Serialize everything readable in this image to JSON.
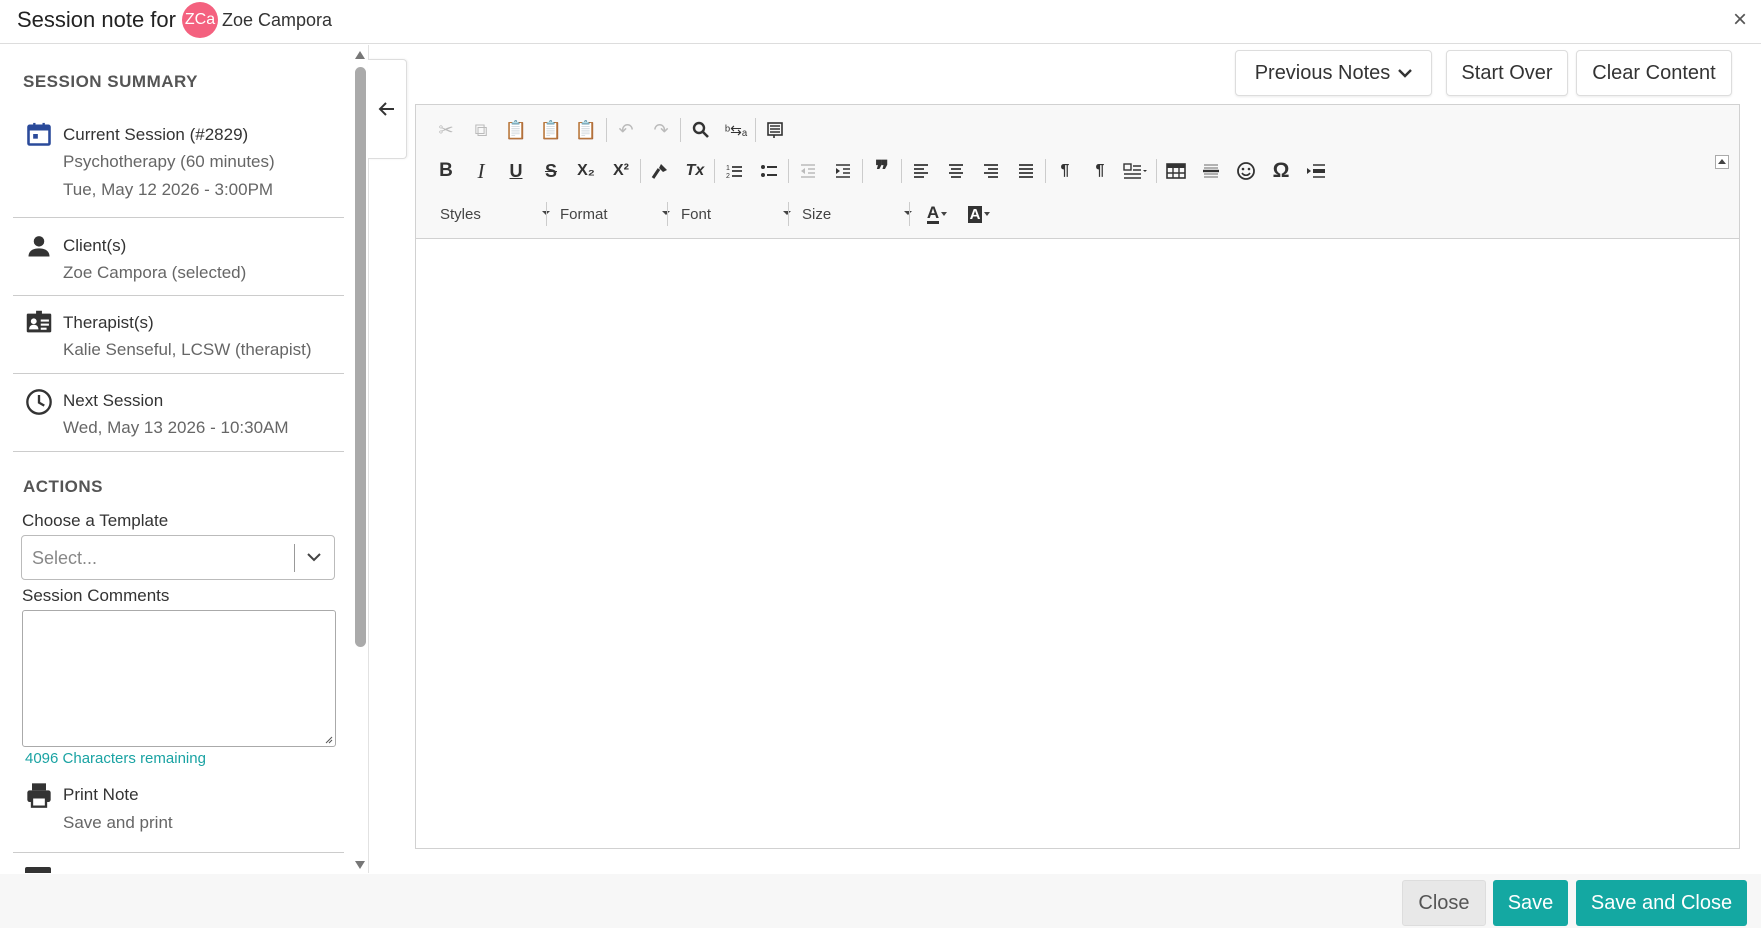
{
  "header": {
    "title_prefix": "Session note for",
    "avatar_initials": "ZCa",
    "client_name": "Zoe Campora",
    "close_label": "×"
  },
  "summary": {
    "heading": "SESSION SUMMARY",
    "current_session": {
      "title": "Current Session (#2829)",
      "line2": "Psychotherapy (60 minutes)",
      "line3": "Tue, May 12 2026 - 3:00PM"
    },
    "clients": {
      "title": "Client(s)",
      "line2": "Zoe Campora (selected)"
    },
    "therapists": {
      "title": "Therapist(s)",
      "line2": "Kalie Senseful, LCSW (therapist)"
    },
    "next_session": {
      "title": "Next Session",
      "line2": "Wed, May 13 2026 - 10:30AM"
    }
  },
  "actions": {
    "heading": "ACTIONS",
    "template_label": "Choose a Template",
    "template_placeholder": "Select...",
    "comments_label": "Session Comments",
    "chars_remaining": "4096 Characters remaining",
    "print": {
      "title": "Print Note",
      "subtitle": "Save and print"
    }
  },
  "top_buttons": {
    "previous_notes": "Previous Notes",
    "start_over": "Start Over",
    "clear_content": "Clear Content"
  },
  "editor": {
    "combos": {
      "styles": "Styles",
      "format": "Format",
      "font": "Font",
      "size": "Size"
    },
    "glyphs": {
      "bold": "B",
      "italic": "I",
      "underline": "U",
      "strike": "S",
      "subscript": "X₂",
      "superscript": "X²",
      "remove_format": "Tx",
      "blockquote": "❞",
      "special_char": "Ω",
      "text_color": "A",
      "bg_color": "A",
      "undo": "↶",
      "redo": "↷",
      "ltr": "¶",
      "rtl": "¶"
    }
  },
  "footer": {
    "close": "Close",
    "save": "Save",
    "save_and_close": "Save and Close"
  },
  "colors": {
    "accent": "#14a8a2",
    "avatar": "#f4617f",
    "chars_remaining": "#1aa3a3",
    "calendar_icon": "#2a4a9a"
  }
}
